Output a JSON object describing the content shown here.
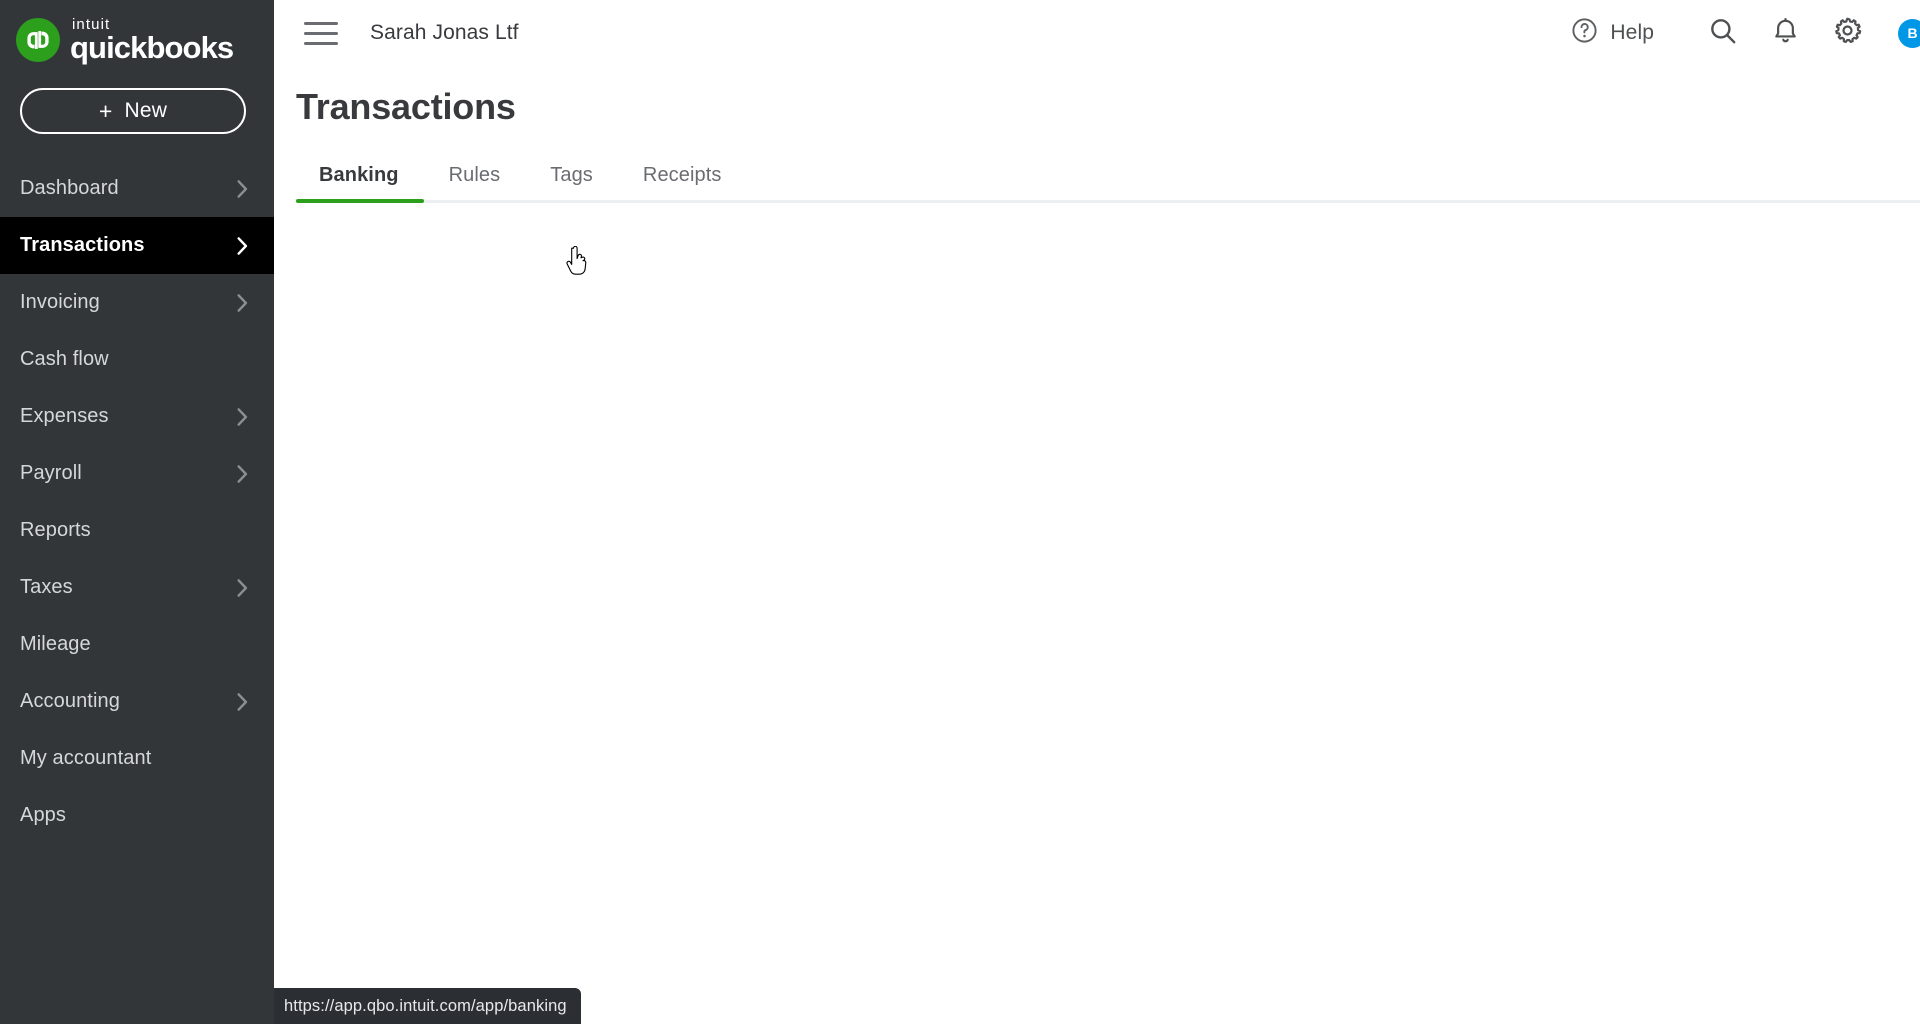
{
  "brand": {
    "intuit": "intuit",
    "product": "quickbooks",
    "logo_mark": "qb-logo-icon",
    "green": "#2CA01C"
  },
  "sidebar": {
    "new_button": {
      "plus": "+",
      "label": "New"
    },
    "items": [
      {
        "label": "Dashboard",
        "chevron": true,
        "active": false
      },
      {
        "label": "Transactions",
        "chevron": true,
        "active": true
      },
      {
        "label": "Invoicing",
        "chevron": true,
        "active": false
      },
      {
        "label": "Cash flow",
        "chevron": false,
        "active": false
      },
      {
        "label": "Expenses",
        "chevron": true,
        "active": false
      },
      {
        "label": "Payroll",
        "chevron": true,
        "active": false
      },
      {
        "label": "Reports",
        "chevron": false,
        "active": false
      },
      {
        "label": "Taxes",
        "chevron": true,
        "active": false
      },
      {
        "label": "Mileage",
        "chevron": false,
        "active": false
      },
      {
        "label": "Accounting",
        "chevron": true,
        "active": false
      },
      {
        "label": "My accountant",
        "chevron": false,
        "active": false
      },
      {
        "label": "Apps",
        "chevron": false,
        "active": false
      }
    ]
  },
  "topbar": {
    "menu_icon": "hamburger-menu-icon",
    "company": "Sarah Jonas Ltf",
    "help_label": "Help",
    "help_icon": "question-circle-icon",
    "search_icon": "search-icon",
    "notifications_icon": "bell-icon",
    "settings_icon": "gear-icon",
    "avatar_initial": "B",
    "avatar_color": "#0097E6"
  },
  "page": {
    "title": "Transactions",
    "tabs": [
      {
        "label": "Banking",
        "active": true
      },
      {
        "label": "Rules",
        "active": false
      },
      {
        "label": "Tags",
        "active": false
      },
      {
        "label": "Receipts",
        "active": false
      }
    ],
    "active_tab_underline_color": "#2CA01C"
  },
  "status_bar": {
    "url": "https://app.qbo.intuit.com/app/banking"
  }
}
